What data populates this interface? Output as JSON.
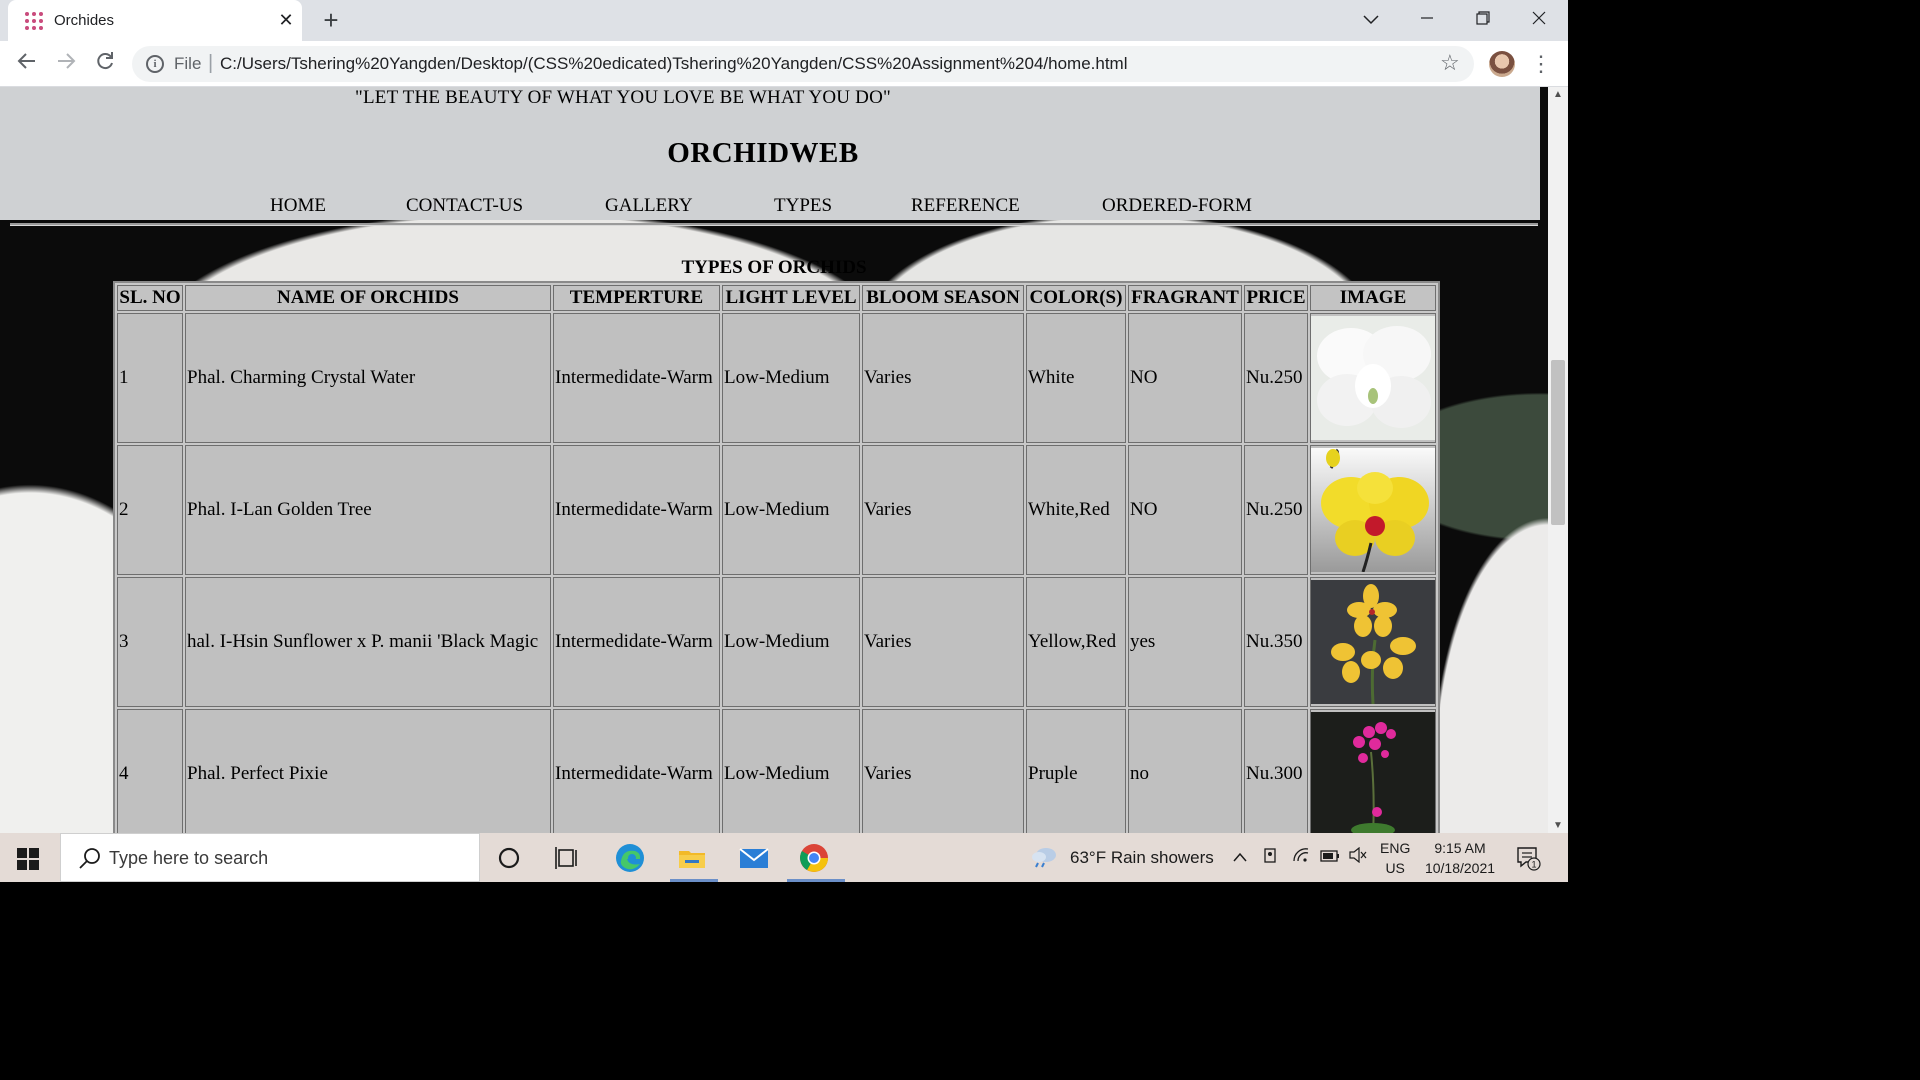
{
  "browser": {
    "tab_title": "Orchides",
    "new_tab_symbol": "+",
    "close_symbol": "✕",
    "url_scheme": "File",
    "url": "C:/Users/Tshering%20Yangden/Desktop/(CSS%20edicated)Tshering%20Yangden/CSS%20Assignment%204/home.html"
  },
  "site": {
    "tagline": "\"LET THE BEAUTY OF WHAT YOU LOVE BE WHAT YOU DO\"",
    "title": "ORCHIDWEB",
    "nav": [
      "HOME",
      "CONTACT-US",
      "GALLERY",
      "TYPES",
      "REFERENCE",
      "ORDERED-FORM"
    ]
  },
  "table": {
    "caption": "TYPES OF ORCHIDS",
    "headers": [
      "SL. NO",
      "NAME OF ORCHIDS",
      "TEMPERTURE",
      "LIGHT LEVEL",
      "BLOOM SEASON",
      "COLOR(S)",
      "FRAGRANT",
      "PRICE",
      "IMAGE"
    ],
    "rows": [
      {
        "sl": "1",
        "name": "Phal. Charming Crystal Water",
        "temp": "Intermedidate-Warm",
        "light": "Low-Medium",
        "season": "Varies",
        "color": "White",
        "fragrant": "NO",
        "price": "Nu.250",
        "image": "white-orchid-photo"
      },
      {
        "sl": "2",
        "name": "Phal. I-Lan Golden Tree",
        "temp": "Intermedidate-Warm",
        "light": "Low-Medium",
        "season": "Varies",
        "color": "White,Red",
        "fragrant": "NO",
        "price": "Nu.250",
        "image": "yellow-orchid-photo"
      },
      {
        "sl": "3",
        "name": "hal. I-Hsin Sunflower x P. manii 'Black Magic",
        "temp": "Intermedidate-Warm",
        "light": "Low-Medium",
        "season": "Varies",
        "color": "Yellow,Red",
        "fragrant": "yes",
        "price": "Nu.350",
        "image": "yellow-spray-orchid-photo"
      },
      {
        "sl": "4",
        "name": "Phal. Perfect Pixie",
        "temp": "Intermedidate-Warm",
        "light": "Low-Medium",
        "season": "Varies",
        "color": "Pruple",
        "fragrant": "no",
        "price": "Nu.300",
        "image": "purple-orchid-photo"
      }
    ]
  },
  "taskbar": {
    "search_placeholder": "Type here to search",
    "weather": "63°F  Rain showers",
    "lang_top": "ENG",
    "lang_bottom": "US",
    "time": "9:15 AM",
    "date": "10/18/2021",
    "notification_count": "1"
  },
  "colors": {
    "header_bg": "#cfd1d3",
    "table_cell_bg": "#c0c0c0",
    "taskbar_bg": "#e4dbd6"
  }
}
